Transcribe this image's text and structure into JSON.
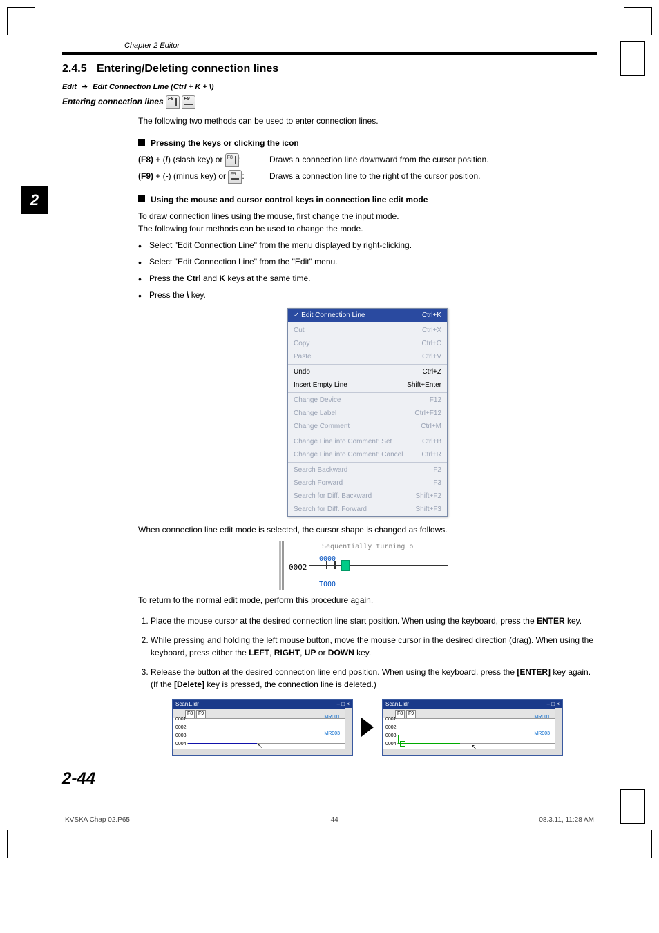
{
  "chapter": "Chapter 2  Editor",
  "side_tab": "2",
  "section": {
    "number": "2.4.5",
    "title": "Entering/Deleting connection lines"
  },
  "breadcrumb": {
    "a": "Edit",
    "arrow": "➔",
    "b": "Edit Connection Line (Ctrl + K + \\)"
  },
  "entering_label": "Entering connection lines",
  "intro": "The following two methods can be used to enter connection lines.",
  "sub1_title": "Pressing the keys or clicking the icon",
  "keytable": [
    {
      "keys_prefix": "(F8)",
      "keys_mid": " + (",
      "keys_key": "/",
      "keys_suffix": ") (slash key) or ",
      "icon": "f8",
      "desc": "Draws a connection line downward from the cursor position."
    },
    {
      "keys_prefix": "(F9)",
      "keys_mid": " + (",
      "keys_key": "-",
      "keys_suffix": ") (minus key) or ",
      "icon": "f9",
      "desc": "Draws a connection line to the right of the cursor position."
    }
  ],
  "sub2_title": "Using the mouse and cursor control keys in connection line edit mode",
  "sub2_p1": "To draw connection lines using the mouse, first change the input mode.",
  "sub2_p2": "The following four methods can be used to change the mode.",
  "bullets": [
    "Select \"Edit Connection Line\" from the menu displayed by right-clicking.",
    "Select \"Edit Connection Line\" from the \"Edit\" menu.",
    {
      "pre": "Press the ",
      "b1": "Ctrl",
      "mid": " and ",
      "b2": "K",
      "post": " keys at the same time."
    },
    {
      "pre": "Press the ",
      "b1": "\\",
      "post": " key."
    }
  ],
  "menu": {
    "highlight": {
      "label": "Edit Connection Line",
      "shortcut": "Ctrl+K"
    },
    "disabled_top": [
      {
        "label": "Cut",
        "shortcut": "Ctrl+X"
      },
      {
        "label": "Copy",
        "shortcut": "Ctrl+C"
      },
      {
        "label": "Paste",
        "shortcut": "Ctrl+V"
      }
    ],
    "middle": [
      {
        "label": "Undo",
        "shortcut": "Ctrl+Z"
      },
      {
        "label": "Insert Empty Line",
        "shortcut": "Shift+Enter"
      }
    ],
    "disabled_mid": [
      {
        "label": "Change Device",
        "shortcut": "F12"
      },
      {
        "label": "Change Label",
        "shortcut": "Ctrl+F12"
      },
      {
        "label": "Change Comment",
        "shortcut": "Ctrl+M"
      }
    ],
    "disabled_mid2": [
      {
        "label": "Change Line into Comment: Set",
        "shortcut": "Ctrl+B"
      },
      {
        "label": "Change Line into Comment: Cancel",
        "shortcut": "Ctrl+R"
      }
    ],
    "disabled_bot": [
      {
        "label": "Search Backward",
        "shortcut": "F2"
      },
      {
        "label": "Search Forward",
        "shortcut": "F3"
      },
      {
        "label": "Search for Diff. Backward",
        "shortcut": "Shift+F2"
      },
      {
        "label": "Search for Diff. Forward",
        "shortcut": "Shift+F3"
      }
    ]
  },
  "cursor_shape_line": "When connection line edit mode is selected, the cursor shape is changed as follows.",
  "ladder": {
    "topnote": "Sequentially turning o",
    "rownum": "0002",
    "dev_top": "0000",
    "dev_bot": "T000"
  },
  "return_line": "To return to the normal edit mode, perform this procedure again.",
  "steps": [
    {
      "pre": "Place the mouse cursor at the desired connection line start position. When using the keyboard, press the ",
      "b1": "ENTER",
      "post": " key."
    },
    {
      "pre": "While pressing and holding the left mouse button, move the mouse cursor in the desired direction (drag). When using the keyboard, press either the ",
      "b1": "LEFT",
      "mid1": ", ",
      "b2": "RIGHT",
      "mid2": ", ",
      "b3": "UP",
      "mid3": " or ",
      "b4": "DOWN",
      "post": " key."
    },
    {
      "pre": "Release the button at the desired connection line end position. When using the keyboard, press the ",
      "b1": "[ENTER]",
      "mid1": " key again. (If the ",
      "b2": "[Delete]",
      "post": " key is pressed, the connection line is deleted.)"
    }
  ],
  "imgbox": {
    "title_left": "Scan1.ldr",
    "title_right": "Scan1.ldr",
    "lines": [
      "0001",
      "0002",
      "0003",
      "0004"
    ],
    "coil0": "MR001",
    "coil1": "MR003",
    "close": "×",
    "min": "–",
    "max": "□"
  },
  "page_number": "2-44",
  "footer": {
    "file": "KVSKA Chap 02.P65",
    "page": "44",
    "datetime": "08.3.11, 11:28 AM"
  }
}
